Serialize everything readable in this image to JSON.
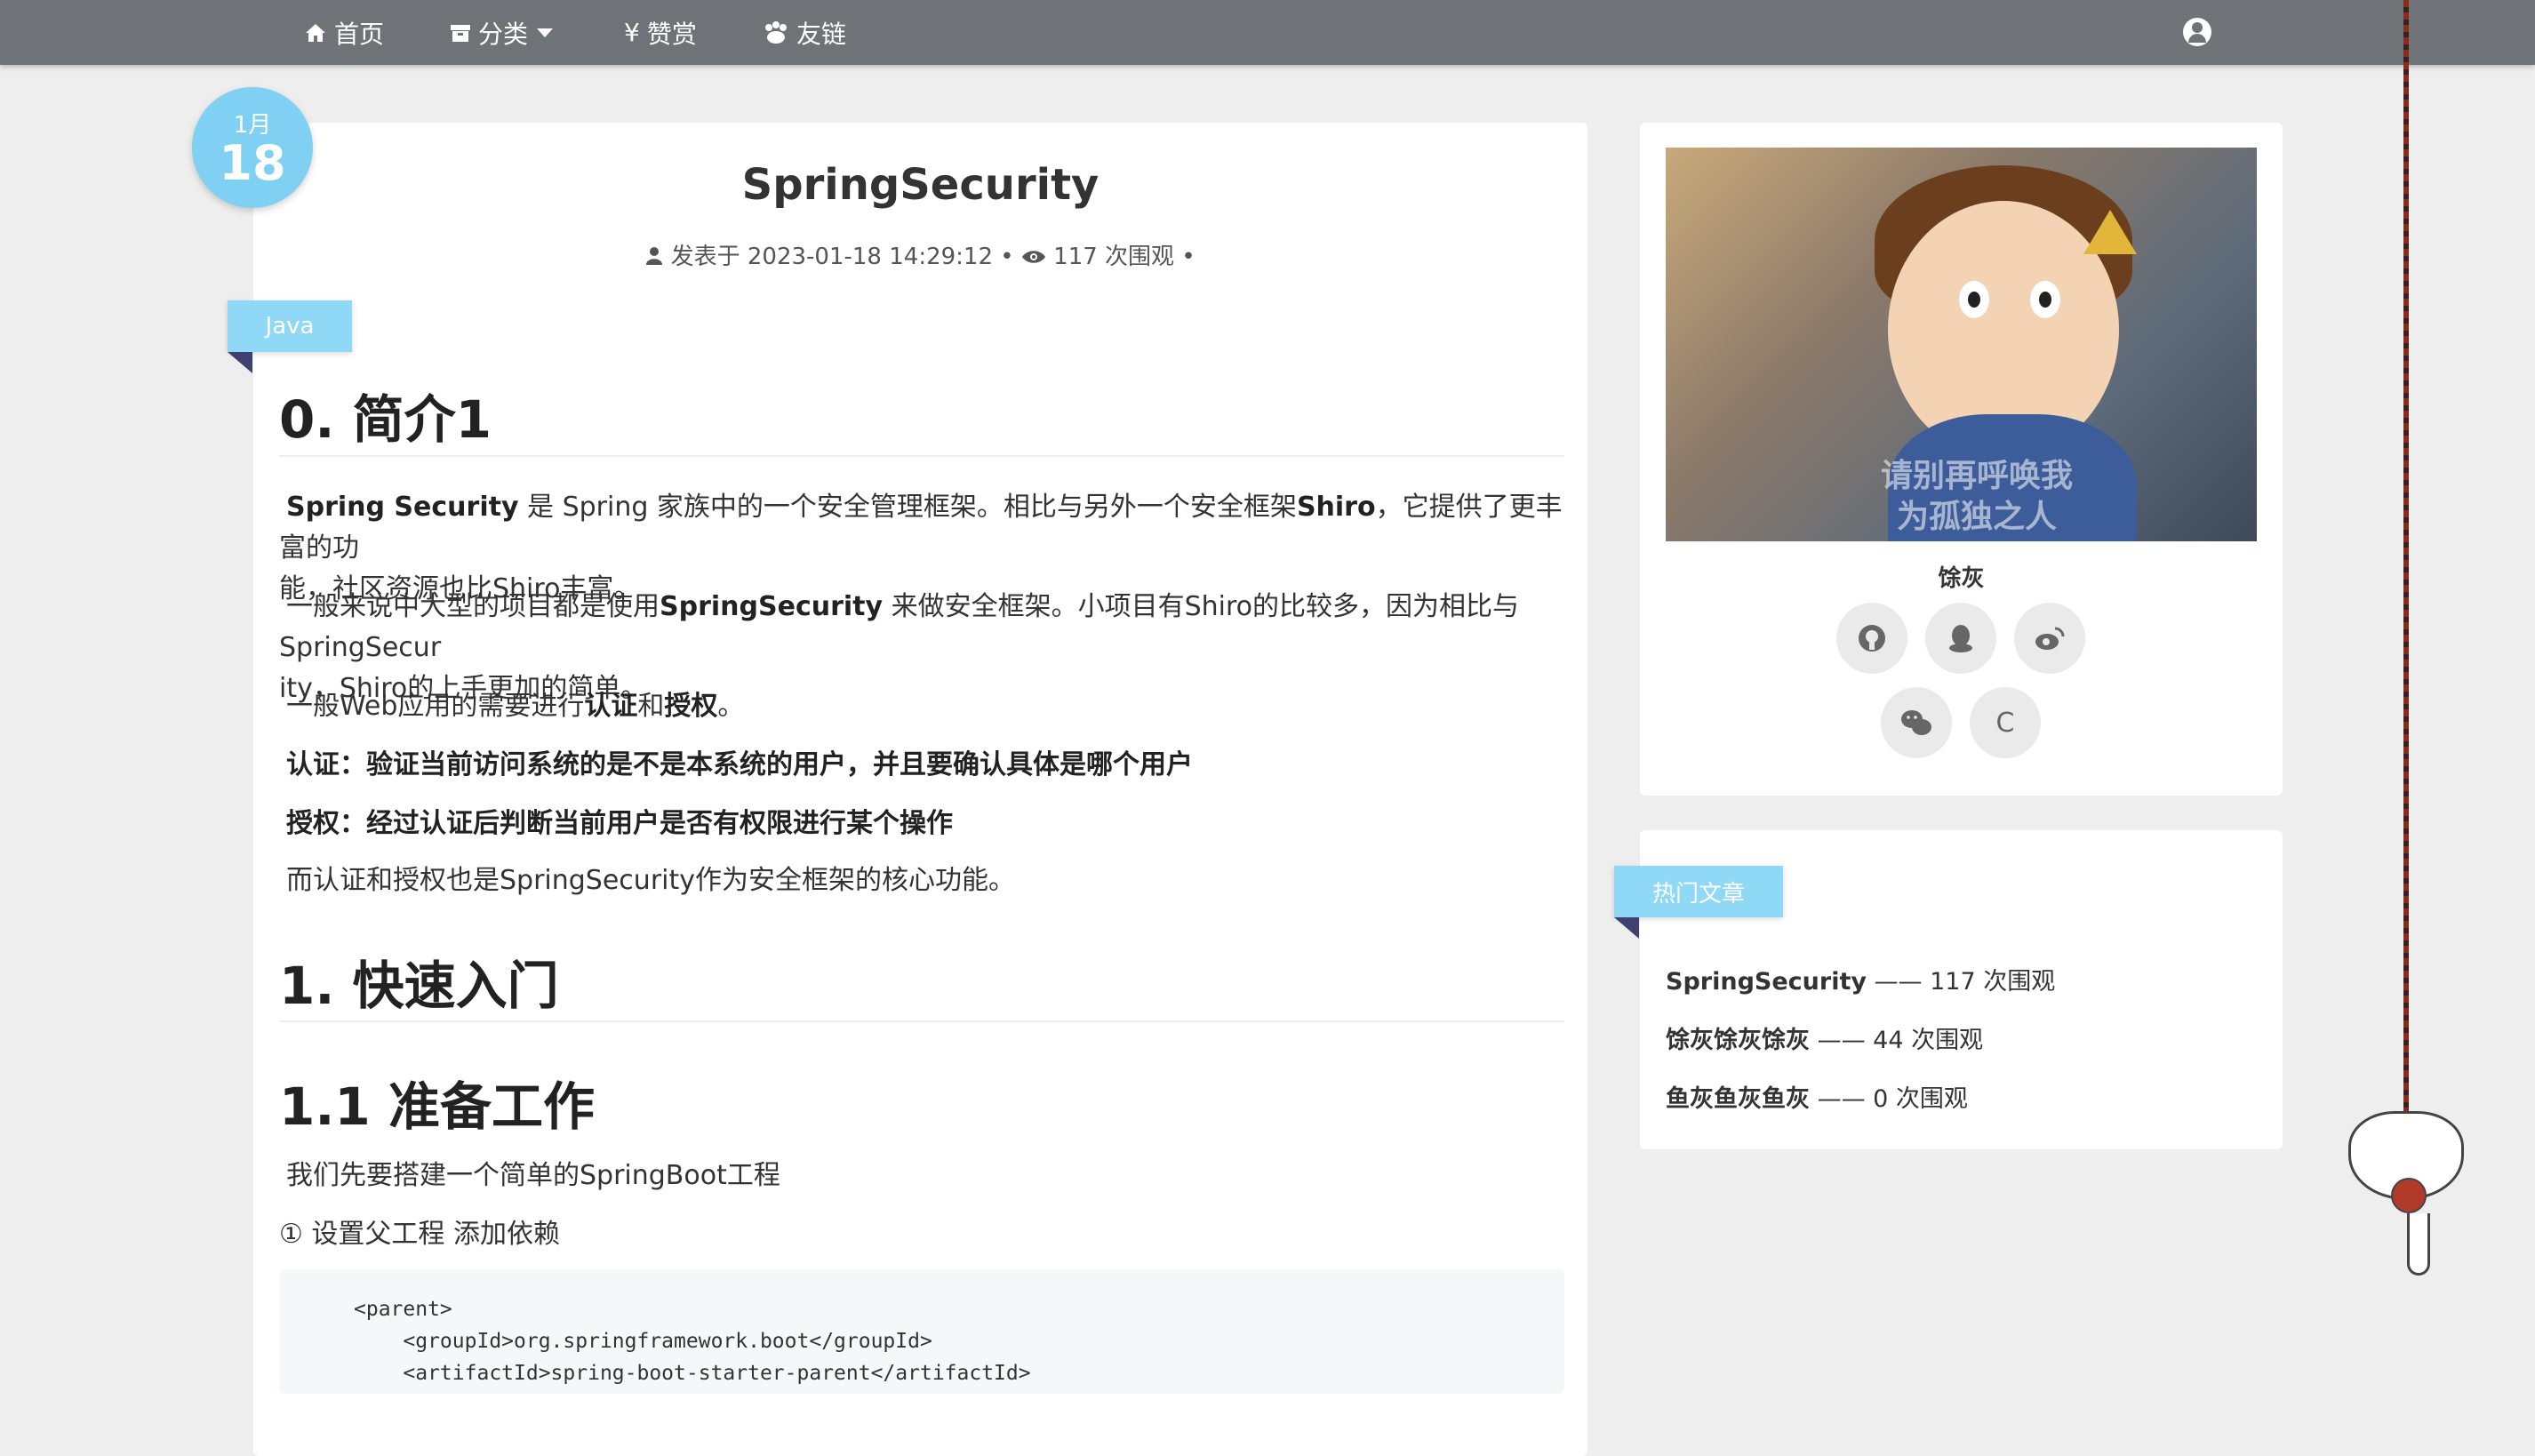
{
  "nav": {
    "items": [
      {
        "label": "首页",
        "icon": "home-icon"
      },
      {
        "label": "分类",
        "icon": "archive-icon",
        "dropdown": true
      },
      {
        "label": "赞赏",
        "icon": "yen-icon"
      },
      {
        "label": "友链",
        "icon": "paw-icon"
      }
    ],
    "user_icon": "user-circle-icon"
  },
  "post": {
    "date_month": "1月",
    "date_day": "18",
    "title": "SpringSecurity",
    "meta": {
      "published_prefix": "发表于",
      "published_at": "2023-01-18 14:29:12",
      "sep": "•",
      "views": "117 次围观",
      "end_sep": "•"
    },
    "category": "Java"
  },
  "content": {
    "h0": "0. 简介1",
    "p1_b1": "Spring Security",
    "p1_t1": " 是 Spring 家族中的一个安全管理框架。相比与另外一个安全框架",
    "p1_b2": "Shiro",
    "p1_t2": "，它提供了更丰富的功",
    "p1_t3": "能，社区资源也比Shiro丰富。",
    "p2_t1": "一般来说中大型的项目都是使用",
    "p2_b1": "SpringSecurity",
    "p2_t2": " 来做安全框架。小项目有Shiro的比较多，因为相比与SpringSecur",
    "p2_t3": "ity，Shiro的上手更加的简单。",
    "p3_t1": "一般Web应用的需要进行",
    "p3_b1": "认证",
    "p3_t2": "和",
    "p3_b2": "授权",
    "p3_t3": "。",
    "p4": "认证：验证当前访问系统的是不是本系统的用户，并且要确认具体是哪个用户",
    "p5": "授权：经过认证后判断当前用户是否有权限进行某个操作",
    "p6": "而认证和授权也是SpringSecurity作为安全框架的核心功能。",
    "h1": "1. 快速入门",
    "h11": "1.1 准备工作",
    "p7": "我们先要搭建一个简单的SpringBoot工程",
    "p8": "① 设置父工程 添加依赖",
    "code": [
      "<parent>",
      "    <groupId>org.springframework.boot</groupId>",
      "    <artifactId>spring-boot-starter-parent</artifactId>"
    ]
  },
  "sidebar": {
    "avatar_caption_1": "请别再呼唤我",
    "avatar_caption_2": "为孤独之人",
    "author": "馀灰",
    "socials": [
      "github-icon",
      "qq-icon",
      "weibo-icon",
      "wechat-icon"
    ],
    "social_c_label": "C",
    "hot_title": "热门文章",
    "hot": [
      {
        "title": "SpringSecurity",
        "views": " —— 117 次围观"
      },
      {
        "title": "馀灰馀灰馀灰",
        "views": " —— 44 次围观"
      },
      {
        "title": "鱼灰鱼灰鱼灰",
        "views": " —— 0 次围观"
      }
    ]
  },
  "colors": {
    "navbar": "#6f7377",
    "accent": "#7fd0f2",
    "ribbon": "#8fd8f6",
    "ribbon_fold": "#3f3f70",
    "background": "#eeeeee"
  }
}
